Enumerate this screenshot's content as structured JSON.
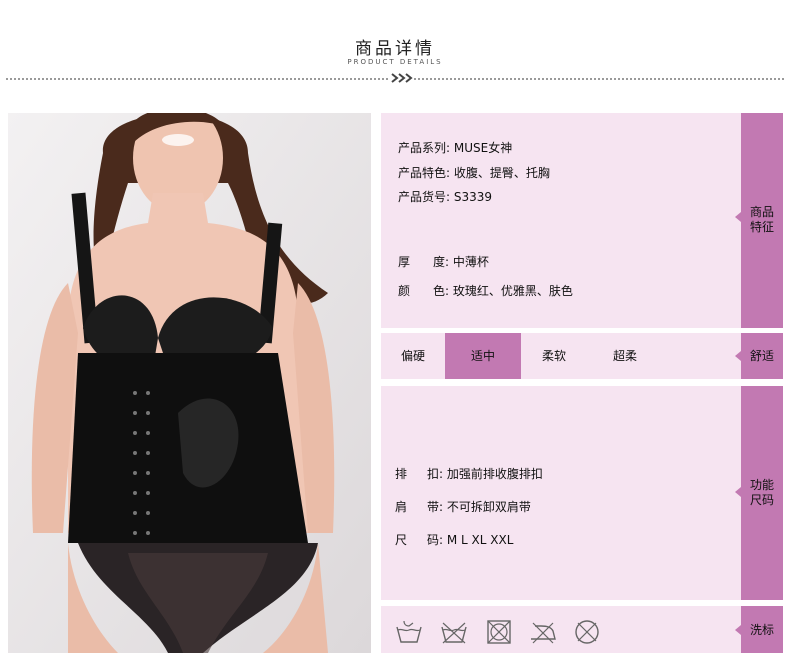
{
  "header": {
    "title": "商品详情",
    "subtitle": "PRODUCT DETAILS"
  },
  "features": {
    "side_label_line1": "商品",
    "side_label_line2": "特征",
    "series": "产品系列: MUSE女神",
    "traits": "产品特色: 收腹、提臀、托胸",
    "item_no": "产品货号: S3339",
    "thickness_label": "厚",
    "thickness_value": "度: 中薄杯",
    "color_label": "颜",
    "color_value": "色: 玫瑰红、优雅黑、肤色"
  },
  "comfort": {
    "side_label": "舒适",
    "options": [
      "偏硬",
      "适中",
      "柔软",
      "超柔"
    ],
    "selected": "适中"
  },
  "function": {
    "side_label_line1": "功能",
    "side_label_line2": "尺码",
    "buckle_label": "排",
    "buckle_value": "扣: 加强前排收腹排扣",
    "strap_label": "肩",
    "strap_value": "带: 不可拆卸双肩带",
    "size_label": "尺",
    "size_value": "码: M L XL XXL"
  },
  "wash": {
    "side_label": "洗标",
    "icons": [
      "hand-wash-icon",
      "no-machine-wash-icon",
      "no-tumble-dry-icon",
      "no-iron-icon",
      "no-dry-clean-icon"
    ]
  },
  "colors": {
    "accent": "#c279b2",
    "panel_bg": "#f6e4f1"
  }
}
